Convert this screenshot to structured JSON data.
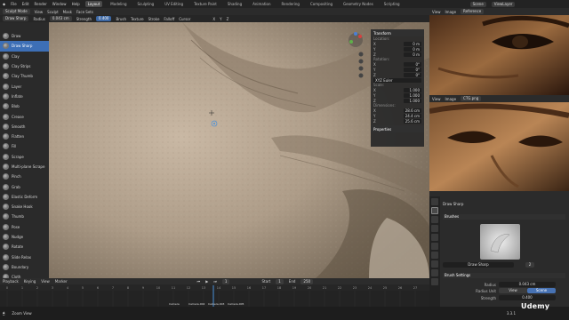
{
  "menubar": {
    "items": [
      "File",
      "Edit",
      "Render",
      "Window",
      "Help"
    ],
    "workspaces": [
      "Layout",
      "Modeling",
      "Sculpting",
      "UV Editing",
      "Texture Paint",
      "Shading",
      "Animation",
      "Rendering",
      "Compositing",
      "Geometry Nodes",
      "Scripting"
    ],
    "active": "Layout",
    "scene": "Scene",
    "view_layer": "ViewLayer"
  },
  "header": {
    "mode": "Sculpt Mode",
    "menus": [
      "View",
      "Sculpt",
      "Mask",
      "Face Sets"
    ],
    "radius_label": "Radius",
    "radius": "0.043 cm",
    "strength_label": "Strength",
    "strength": "0.400",
    "tools": [
      "Brush",
      "Texture",
      "Stroke",
      "Falloff",
      "Cursor"
    ]
  },
  "header2": {
    "brush": "Draw Sharp",
    "x": "X",
    "y": "Y",
    "z": "Z"
  },
  "brushes": [
    "Draw",
    "Draw Sharp",
    "Clay",
    "Clay Strips",
    "Clay Thumb",
    "Layer",
    "Inflate",
    "Blob",
    "Crease",
    "Smooth",
    "Flatten",
    "Fill",
    "Scrape",
    "Multi-plane Scrape",
    "Pinch",
    "Grab",
    "Elastic Deform",
    "Snake Hook",
    "Thumb",
    "Pose",
    "Nudge",
    "Rotate",
    "Slide Relax",
    "Boundary",
    "Cloth"
  ],
  "active_brush": "Draw Sharp",
  "npanel": {
    "title": "Transform",
    "location": "Location:",
    "loc": [
      [
        "X",
        "0 m"
      ],
      [
        "Y",
        "0 m"
      ],
      [
        "Z",
        "0 m"
      ]
    ],
    "rotation": "Rotation:",
    "rot": [
      [
        "X",
        "0°"
      ],
      [
        "Y",
        "0°"
      ],
      [
        "Z",
        "0°"
      ]
    ],
    "mode": "XYZ Euler",
    "scale": "Scale:",
    "sc": [
      [
        "X",
        "1.000"
      ],
      [
        "Y",
        "1.000"
      ],
      [
        "Z",
        "1.000"
      ]
    ],
    "dimensions": "Dimensions:",
    "dim": [
      [
        "X",
        "28.6 cm"
      ],
      [
        "Y",
        "24.4 cm"
      ],
      [
        "Z",
        "25.6 cm"
      ]
    ],
    "properties": "Properties"
  },
  "timeline": {
    "menus": [
      "Playback",
      "Keying",
      "View",
      "Marker"
    ],
    "current_frame": "1",
    "start": "Start",
    "start_val": "1",
    "end": "End",
    "end_val": "250",
    "ticks": [
      "0",
      "1",
      "2",
      "3",
      "4",
      "5",
      "6",
      "7",
      "8",
      "9",
      "10",
      "11",
      "12",
      "13",
      "14",
      "15",
      "16",
      "17",
      "18",
      "19",
      "20",
      "21",
      "22",
      "23",
      "24",
      "25",
      "26",
      "27"
    ],
    "markers": [
      "Camera",
      "Camera.002",
      "Camera.003",
      "Camera.005"
    ]
  },
  "status": {
    "left": "Zoom View",
    "version": "3.3.1"
  },
  "right_top": {
    "menus": [
      "View",
      "Image"
    ],
    "title": "Reference"
  },
  "right_mid": {
    "menus": [
      "View",
      "Image",
      "Image"
    ],
    "title": "CTG.png"
  },
  "props": {
    "brush": "Draw Sharp",
    "brushes_section": "Brushes",
    "brush_name": "Draw Sharp",
    "brush_users": "2",
    "settings_section": "Brush Settings",
    "radius_label": "Radius",
    "radius": "0.043 cm",
    "radius_unit_label": "Radius Unit",
    "unit_view": "View",
    "unit_scene": "Scene",
    "strength_label": "Strength",
    "strength": "0.400"
  },
  "watermark": "Udemy"
}
